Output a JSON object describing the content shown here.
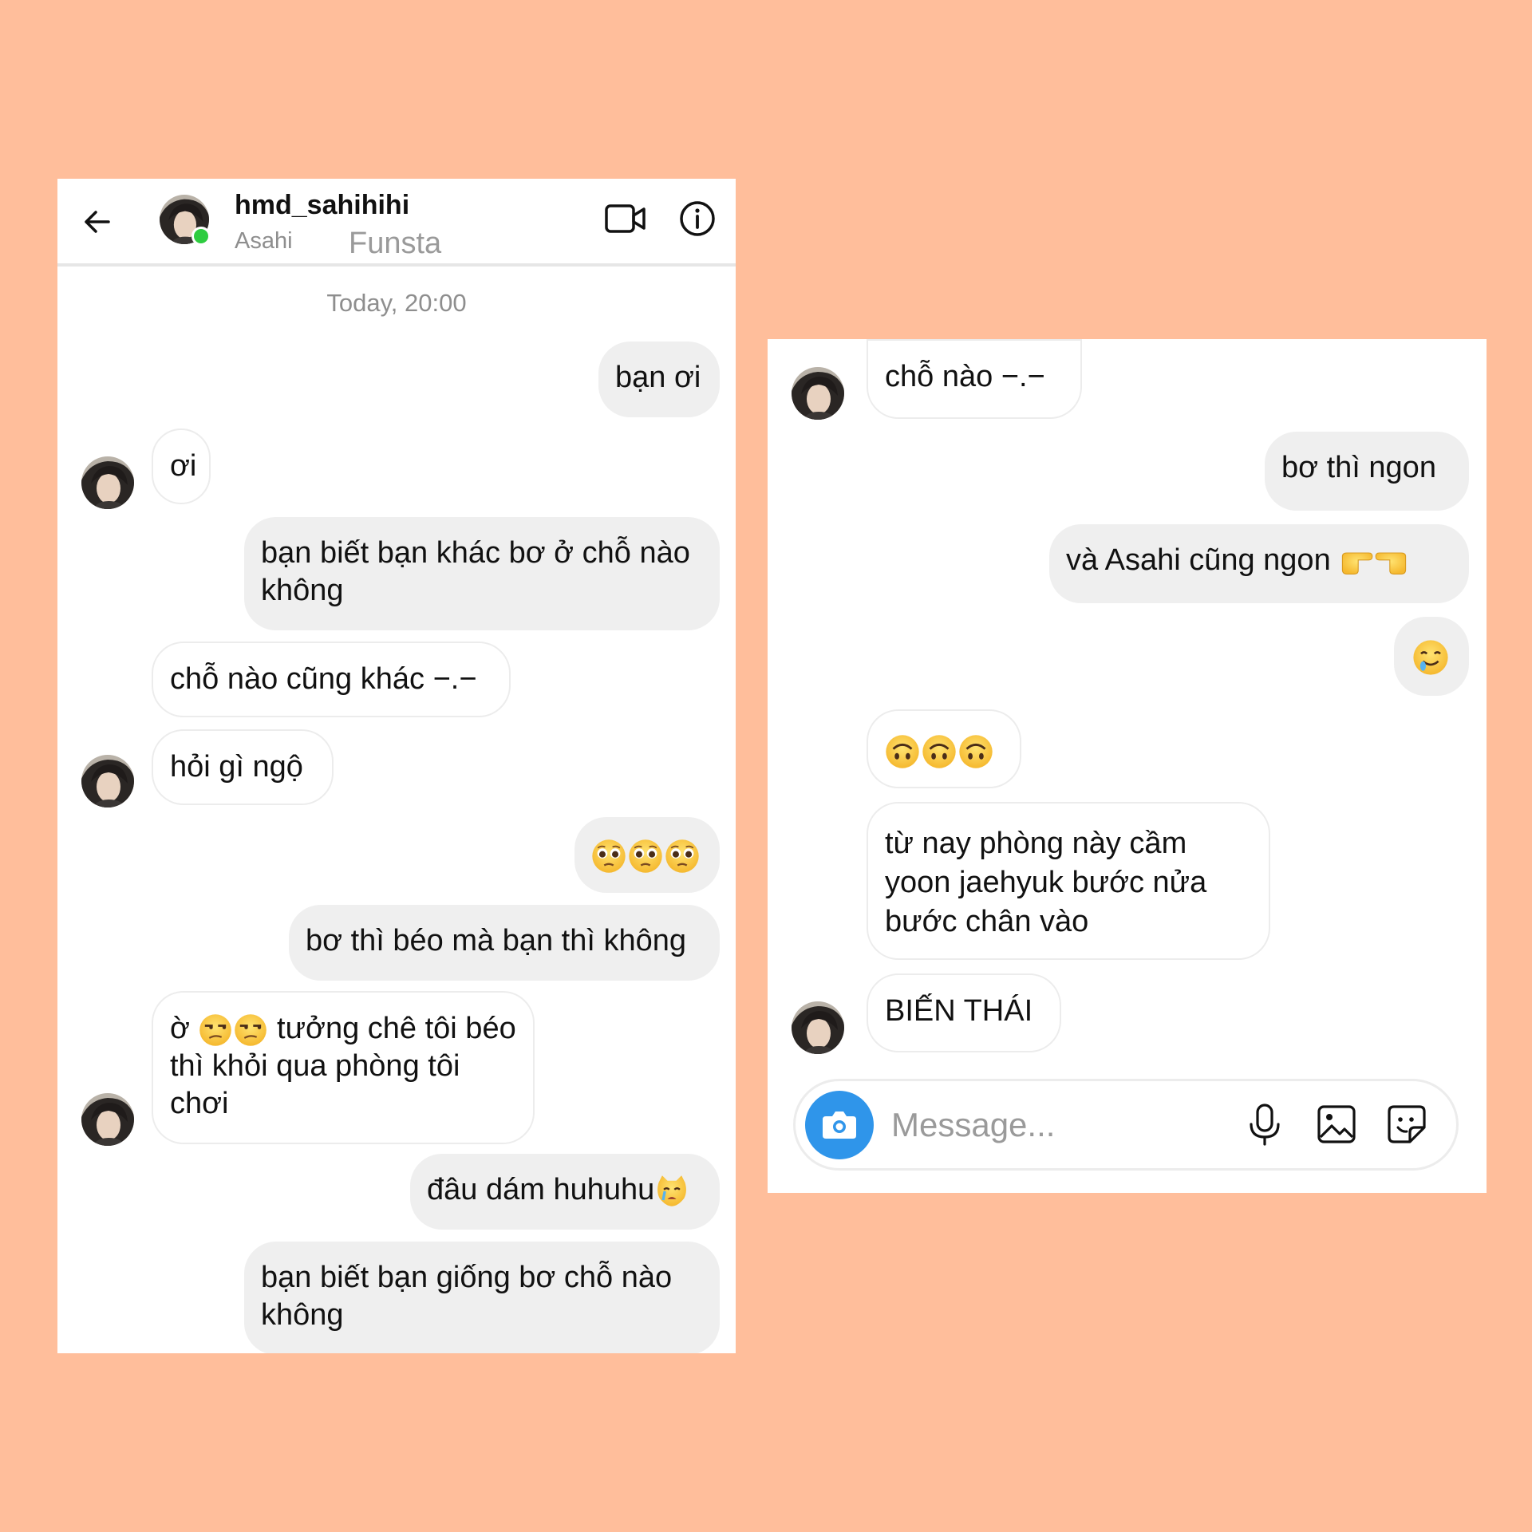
{
  "header": {
    "username": "hmd_sahihihi",
    "display_name": "Asahi",
    "account_label": "Funsta"
  },
  "thread": {
    "timestamp": "Today, 20:00",
    "left": [
      {
        "side": "out",
        "text": "bạn ơi"
      },
      {
        "side": "in",
        "text": "ơi"
      },
      {
        "side": "out",
        "text": "bạn biết bạn khác bơ ở chỗ nào không"
      },
      {
        "side": "in",
        "text": "chỗ nào cũng khác −.−"
      },
      {
        "side": "in",
        "text": "hỏi gì ngộ"
      },
      {
        "side": "out",
        "text": "",
        "emoji": [
          "pleading",
          "pleading",
          "pleading"
        ]
      },
      {
        "side": "out",
        "text": "bơ thì béo mà bạn thì không"
      },
      {
        "side": "in",
        "text_prefix": "ờ",
        "emoji": [
          "unamused",
          "unamused"
        ],
        "text": "tưởng chê tôi béo thì khỏi qua phòng tôi chơi"
      },
      {
        "side": "out",
        "text": "đâu dám huhuhu",
        "emoji": [
          "crying-cat"
        ]
      },
      {
        "side": "out",
        "text": "bạn biết bạn giống bơ chỗ nào không"
      }
    ],
    "right": [
      {
        "side": "in",
        "text": "chỗ nào −.−"
      },
      {
        "side": "out",
        "text": "bơ thì ngon"
      },
      {
        "side": "out",
        "text": "và Asahi cũng ngon",
        "emoji": [
          "point-right",
          "point-left"
        ]
      },
      {
        "side": "out",
        "text": "",
        "emoji": [
          "drooling"
        ]
      },
      {
        "side": "in",
        "text": "",
        "emoji": [
          "upside-down",
          "upside-down",
          "upside-down"
        ]
      },
      {
        "side": "in",
        "text": "từ nay phòng này cầm yoon jaehyuk bước nửa bước chân vào"
      },
      {
        "side": "in",
        "text": "BIẾN THÁI"
      }
    ]
  },
  "composer": {
    "placeholder": "Message..."
  },
  "colors": {
    "background": "#FFBE9B",
    "outgoing_bubble": "#efefef",
    "camera_button": "#2f95ea",
    "online_dot": "#2ecc40"
  }
}
